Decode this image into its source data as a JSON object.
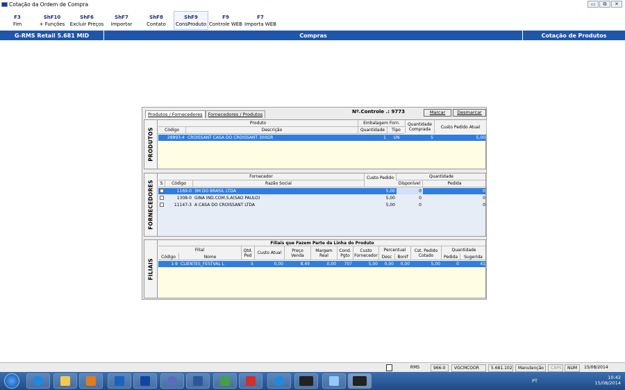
{
  "window": {
    "title": "Cotação da Ordem de Compra",
    "controls": [
      "▭",
      "⧉",
      "✕"
    ]
  },
  "fkeys": [
    {
      "key": "F3",
      "label": "Fim"
    },
    {
      "key": "ShF10",
      "label": "+ Funções"
    },
    {
      "key": "ShF6",
      "label": "Excluir Preços"
    },
    {
      "key": "ShF7",
      "label": "Importar"
    },
    {
      "key": "ShF8",
      "label": "Contato"
    },
    {
      "key": "ShF9",
      "label": "ConsProduto"
    },
    {
      "key": "F9",
      "label": "Controle WEB"
    },
    {
      "key": "F7",
      "label": "Importa WEB"
    }
  ],
  "header": {
    "system": "G-RMS Retail 5.681 MID",
    "module": "Compras",
    "screen": "Cotação de Produtos",
    "color": "#1f56a8"
  },
  "tabs": [
    "Produtos / Fornecedores",
    "Fornecedores / Produtos"
  ],
  "controle": "Nº.Controle .: 9773",
  "buttons": {
    "marcar": "Marcar",
    "desmarcar": "Desmarcar"
  },
  "produtos": {
    "side": "PRODUTOS",
    "h_produto": "Produto",
    "h_embalagem": "Embalagem Forn.",
    "h_qtd_comprada": "Quantidade Comprada",
    "h_custo": "Custo Pedido Atual",
    "h_codigo": "Código",
    "h_descricao": "Descrição",
    "h_quantidade": "Quantidade",
    "h_tipo": "Tipo",
    "rows": [
      {
        "codigo": "28893-4",
        "descricao": "CROISSANT CASA DO CROISSANT 300GR",
        "quantidade": "1",
        "tipo": "UN",
        "comprada": "5",
        "custo": "5,00"
      }
    ]
  },
  "fornecedores": {
    "side": "FORNECEDORES",
    "h_fornecedor": "Fornecedor",
    "h_custo": "Custo Pedido Cotado",
    "h_quantidade": "Quantidade",
    "h_s": "S",
    "h_codigo": "Código",
    "h_razao": "Razão Social",
    "h_disp": "Disponível",
    "h_pedida": "Pedida",
    "rows": [
      {
        "codigo": "1169-0",
        "razao": "3M DO BRASIL LTDA",
        "custo": "5,00",
        "disp": "0",
        "pedida": "0"
      },
      {
        "codigo": "1308-0",
        "razao": "GINA IND.COM.S.A(SAO PAULO)",
        "custo": "5,00",
        "disp": "0",
        "pedida": "0"
      },
      {
        "codigo": "11147-3",
        "razao": "A CASA DO CROISSANT LTDA",
        "custo": "5,00",
        "disp": "0",
        "pedida": "0"
      }
    ]
  },
  "filiais": {
    "side": "FILIAIS",
    "title": "Filiais que Fazem Parte da Linha do Produto",
    "h_filial": "Filial",
    "h_qtd_ped": "Qtd. Ped",
    "h_custo_atual": "Custo Atual",
    "h_preco": "Preço Venda",
    "h_margem": "Margem Real",
    "h_cond": "Cond. Pgto",
    "h_custo_forn": "Custo Fornecedor",
    "h_percentual": "Percentual",
    "h_cst": "Cst. Pedido Cotado",
    "h_quantidade": "Quantidade",
    "h_codigo": "Código",
    "h_nome": "Nome",
    "h_desc": "Desc",
    "h_bonif": "Bonif",
    "h_pedida": "Pedida",
    "h_sugerida": "Sugerida",
    "rows": [
      {
        "codigo": "1-9",
        "nome": "CLIENTES_FESTVAL L",
        "qtd": "5",
        "custo_atual": "0,00",
        "preco": "8,49",
        "margem": "0,00",
        "cond": "707",
        "custo_forn": "5,00",
        "desc": "0,00",
        "bonif": "0,00",
        "cst": "5,00",
        "pedida": "0",
        "sugerida": "41"
      }
    ]
  },
  "status": {
    "rms": "RMS",
    "code": "966-0",
    "user": "VGCMCOOR",
    "version": "5.681.102",
    "mode": "Manutenção",
    "caps": "CAPS",
    "num": "NUM",
    "date": "15/08/2014"
  },
  "tray": {
    "lang": "PT",
    "time": "10:42",
    "date": "15/08/2014"
  }
}
